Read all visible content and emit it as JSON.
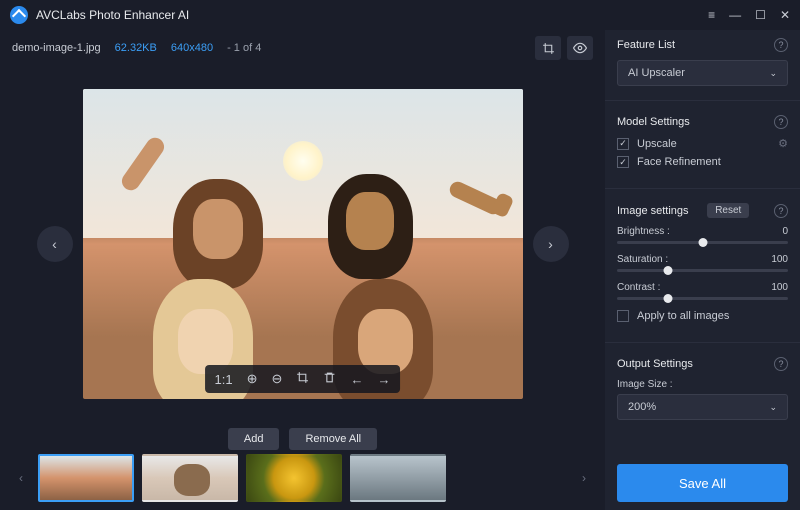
{
  "app_title": "AVCLabs Photo Enhancer AI",
  "file": {
    "name": "demo-image-1.jpg",
    "size": "62.32KB",
    "dims": "640x480",
    "index": "- 1 of 4"
  },
  "toolbar": {
    "ratio": "1:1"
  },
  "thumb_actions": {
    "add": "Add",
    "remove_all": "Remove All"
  },
  "sidebar": {
    "feature_list": {
      "title": "Feature List",
      "selected": "AI Upscaler"
    },
    "model_settings": {
      "title": "Model Settings",
      "upscale": "Upscale",
      "face_refine": "Face Refinement"
    },
    "image_settings": {
      "title": "Image settings",
      "reset": "Reset",
      "brightness": {
        "label": "Brightness :",
        "value": "0",
        "pos": 50
      },
      "saturation": {
        "label": "Saturation :",
        "value": "100",
        "pos": 30
      },
      "contrast": {
        "label": "Contrast :",
        "value": "100",
        "pos": 30
      },
      "apply_all": "Apply to all images"
    },
    "output": {
      "title": "Output Settings",
      "size_label": "Image Size :",
      "size_value": "200%"
    }
  },
  "save": "Save All"
}
